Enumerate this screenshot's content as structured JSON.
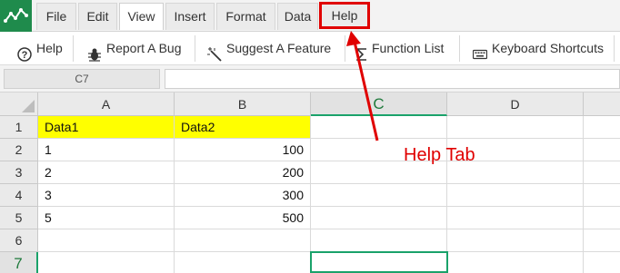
{
  "menu": {
    "items": [
      {
        "label": "File"
      },
      {
        "label": "Edit"
      },
      {
        "label": "View"
      },
      {
        "label": "Insert"
      },
      {
        "label": "Format"
      },
      {
        "label": "Data"
      },
      {
        "label": "Help"
      }
    ],
    "active": "View",
    "highlighted": "Help"
  },
  "toolbar": {
    "help_label": "Help",
    "report_bug_label": "Report A Bug",
    "suggest_feature_label": "Suggest A Feature",
    "function_list_label": "Function List",
    "keyboard_shortcuts_label": "Keyboard Shortcuts"
  },
  "formula_bar": {
    "cell_reference": "C7",
    "formula": ""
  },
  "sheet": {
    "columns": [
      "A",
      "B",
      "C",
      "D"
    ],
    "rows": [
      "1",
      "2",
      "3",
      "4",
      "5",
      "6",
      "7"
    ],
    "selected_column": "C",
    "selected_row": "7",
    "cells": {
      "A1": "Data1",
      "B1": "Data2",
      "A2": "1",
      "B2": "100",
      "A3": "2",
      "B3": "200",
      "A4": "3",
      "B4": "300",
      "A5": "5",
      "B5": "500"
    },
    "highlight_color": "#ffff00",
    "selection_color": "#1aa26a"
  },
  "annotation": {
    "label": "Help Tab",
    "color": "#e00000"
  },
  "colors": {
    "brand": "#1f8b4c",
    "accent": "#1aa26a",
    "annotation": "#e00000"
  }
}
